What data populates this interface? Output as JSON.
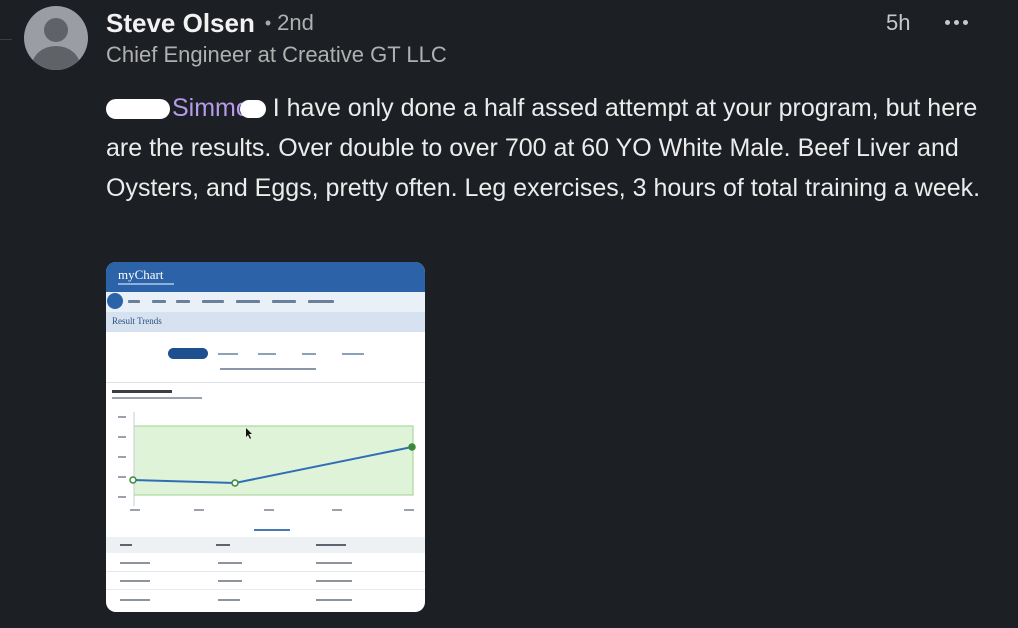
{
  "post": {
    "author": {
      "name": "Steve Olsen",
      "separator": "•",
      "degree": "2nd",
      "headline": "Chief Engineer at Creative GT LLC"
    },
    "time": "5h",
    "more_icon": "ellipsis-icon",
    "mention": "Simmo",
    "comment_text": " I have only done a half assed attempt at your program, but here are the results. Over double to over 700 at 60 YO White Male. Beef Liver and Oysters, and Eggs, pretty often. Leg exercises, 3 hours of total training a week."
  },
  "attachment": {
    "app_name": "myChart",
    "section_title": "Result Trends",
    "line_color": "#2e6fb5",
    "band_color": "#dff3d8"
  },
  "colors": {
    "background": "#1c1f23",
    "mention": "#b79ae8",
    "mychart_blue": "#2c62a8"
  }
}
